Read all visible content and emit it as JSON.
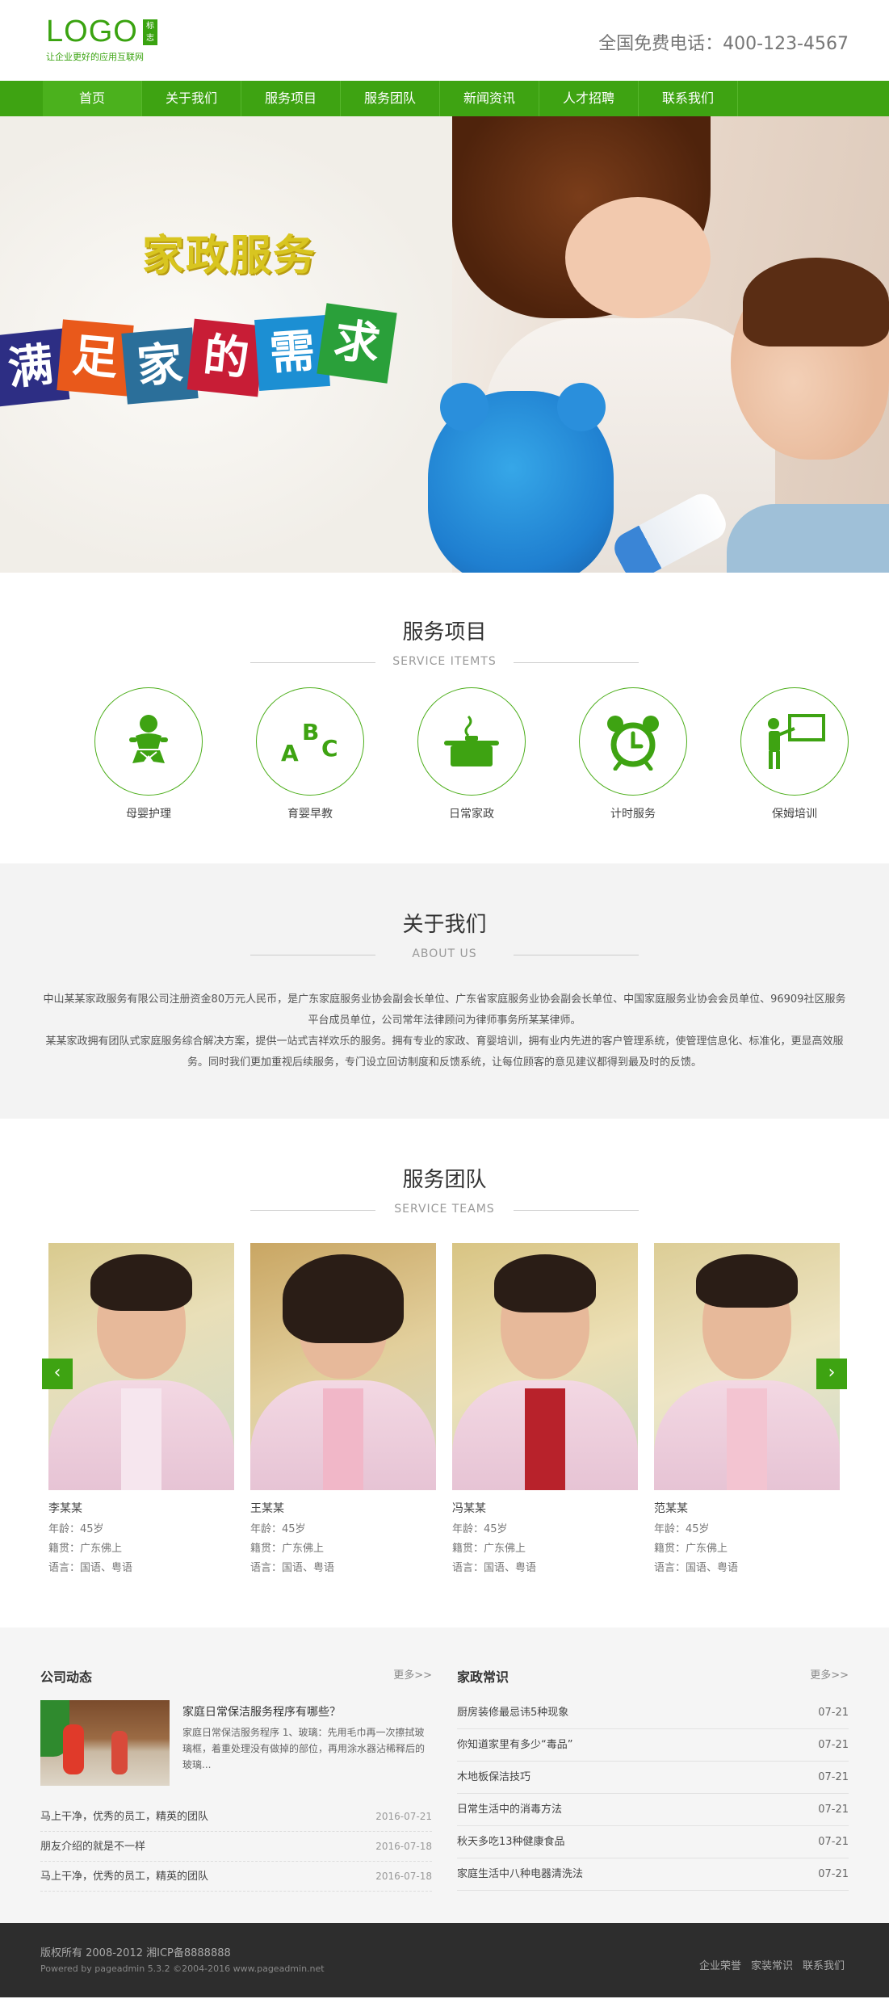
{
  "header": {
    "logo": "LOGO",
    "logo_badge": "标志",
    "slogan": "让企业更好的应用互联网",
    "hotline": "全国免费电话：400-123-4567"
  },
  "nav": [
    "首页",
    "关于我们",
    "服务项目",
    "服务团队",
    "新闻资讯",
    "人才招聘",
    "联系我们"
  ],
  "banner": {
    "title": "家政服务",
    "tiles": [
      "满",
      "足",
      "家",
      "的",
      "需",
      "求"
    ]
  },
  "services": {
    "title": "服务项目",
    "subtitle": "SERVICE ITEMTS",
    "items": [
      {
        "label": "母婴护理",
        "icon": "baby-icon"
      },
      {
        "label": "育婴早教",
        "icon": "abc-icon"
      },
      {
        "label": "日常家政",
        "icon": "cooking-pot-icon"
      },
      {
        "label": "计时服务",
        "icon": "alarm-clock-icon"
      },
      {
        "label": "保姆培训",
        "icon": "teacher-board-icon"
      }
    ]
  },
  "about": {
    "title": "关于我们",
    "subtitle": "ABOUT US",
    "paragraphs": [
      "中山某某家政服务有限公司注册资金80万元人民币，是广东家庭服务业协会副会长单位、广东省家庭服务业协会副会长单位、中国家庭服务业协会会员单位、96909社区服务平台成员单位，公司常年法律顾问为律师事务所某某律师。",
      "某某家政拥有团队式家庭服务综合解决方案，提供一站式吉祥欢乐的服务。拥有专业的家政、育婴培训，拥有业内先进的客户管理系统，使管理信息化、标准化，更显高效服务。同时我们更加重视后续服务，专门设立回访制度和反馈系统，让每位顾客的意见建议都得到最及时的反馈。"
    ]
  },
  "teams": {
    "title": "服务团队",
    "subtitle": "SERVICE TEAMS",
    "prev": "‹",
    "next": "›",
    "members": [
      {
        "name": "李某某",
        "age": "年龄：45岁",
        "origin": "籍贯：广东佛上",
        "lang": "语言：国语、粤语"
      },
      {
        "name": "王某某",
        "age": "年龄：45岁",
        "origin": "籍贯：广东佛上",
        "lang": "语言：国语、粤语"
      },
      {
        "name": "冯某某",
        "age": "年龄：45岁",
        "origin": "籍贯：广东佛上",
        "lang": "语言：国语、粤语"
      },
      {
        "name": "范某某",
        "age": "年龄：45岁",
        "origin": "籍贯：广东佛上",
        "lang": "语言：国语、粤语"
      }
    ]
  },
  "company_news": {
    "title": "公司动态",
    "more": "更多>>",
    "feature_title": "家庭日常保洁服务程序有哪些？",
    "feature_desc": "家庭日常保洁服务程序 1、玻璃：先用毛巾再一次擦拭玻璃框，着重处理没有做掉的部位，再用涂水器沾稀释后的玻璃...",
    "items": [
      {
        "title": "马上干净，优秀的员工，精英的团队",
        "date": "2016-07-21"
      },
      {
        "title": "朋友介绍的就是不一样",
        "date": "2016-07-18"
      },
      {
        "title": "马上干净，优秀的员工，精英的团队",
        "date": "2016-07-18"
      }
    ]
  },
  "knowledge": {
    "title": "家政常识",
    "more": "更多>>",
    "items": [
      {
        "title": "厨房装修最忌讳5种现象",
        "date": "07-21"
      },
      {
        "title": "你知道家里有多少“毒品”",
        "date": "07-21"
      },
      {
        "title": "木地板保洁技巧",
        "date": "07-21"
      },
      {
        "title": "日常生活中的消毒方法",
        "date": "07-21"
      },
      {
        "title": "秋天多吃13种健康食品",
        "date": "07-21"
      },
      {
        "title": "家庭生活中八种电器清洗法",
        "date": "07-21"
      }
    ]
  },
  "footer": {
    "copyright": "版权所有 2008-2012 湘ICP备8888888",
    "powered": "Powered by pageadmin 5.3.2 ©2004-2016 www.pageadmin.net",
    "links": [
      "企业荣誉",
      "家装常识",
      "联系我们"
    ]
  },
  "colors": {
    "brand_green": "#3ea312"
  }
}
